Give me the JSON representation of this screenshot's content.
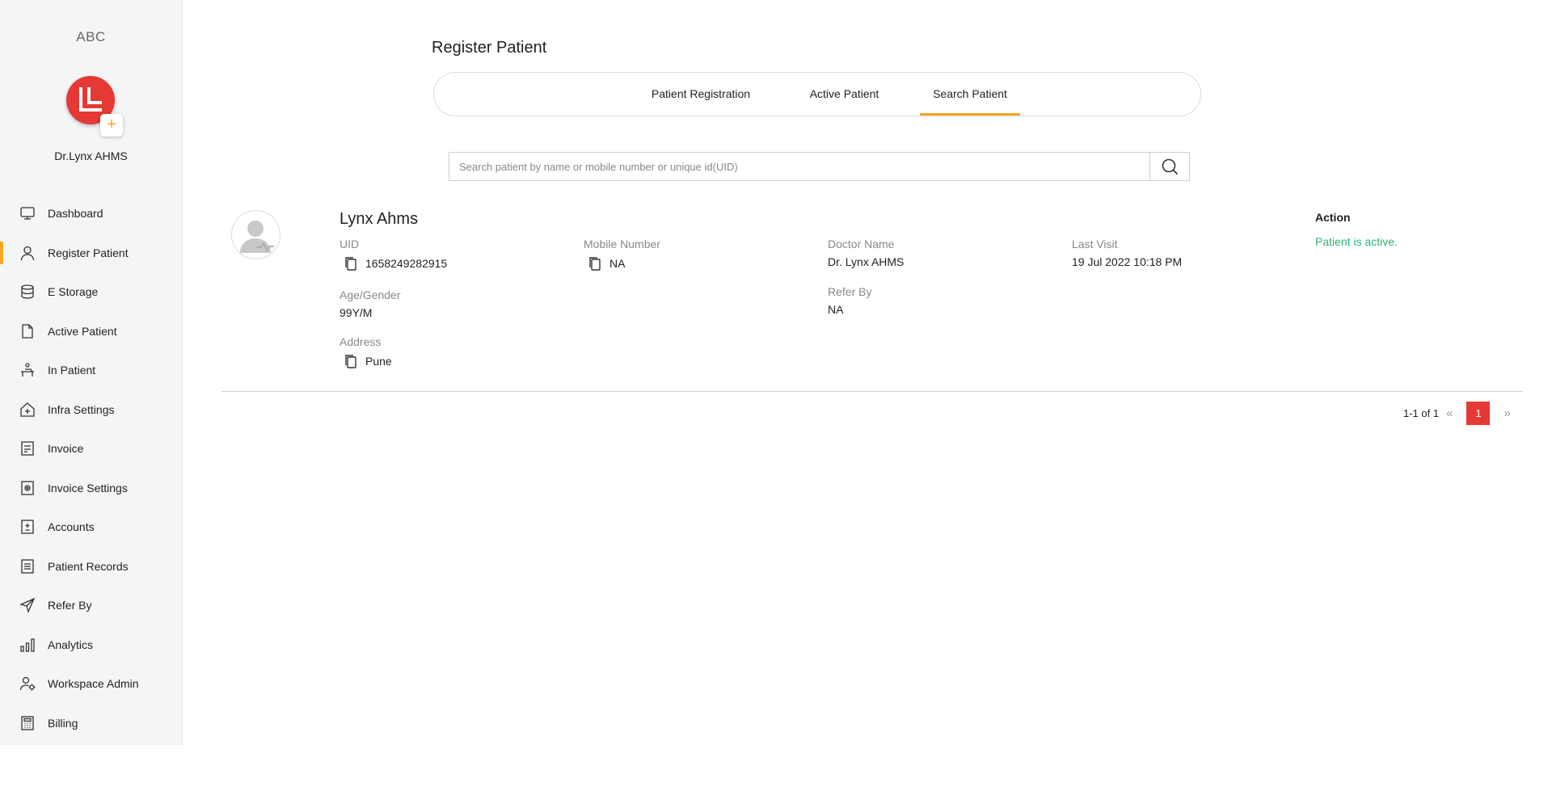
{
  "sidebar": {
    "brand": "ABC",
    "user_name": "Dr.Lynx AHMS",
    "add_symbol": "+",
    "items": [
      {
        "label": "Dashboard",
        "icon": "monitor-icon"
      },
      {
        "label": "Register Patient",
        "icon": "user-icon",
        "active": true
      },
      {
        "label": "E Storage",
        "icon": "database-icon"
      },
      {
        "label": "Active Patient",
        "icon": "file-icon"
      },
      {
        "label": "In Patient",
        "icon": "bed-icon"
      },
      {
        "label": "Infra Settings",
        "icon": "house-plus-icon"
      },
      {
        "label": "Invoice",
        "icon": "invoice-icon"
      },
      {
        "label": "Invoice Settings",
        "icon": "invoice-settings-icon"
      },
      {
        "label": "Accounts",
        "icon": "accounts-icon"
      },
      {
        "label": "Patient Records",
        "icon": "records-icon"
      },
      {
        "label": "Refer By",
        "icon": "send-icon"
      },
      {
        "label": "Analytics",
        "icon": "bar-chart-icon"
      },
      {
        "label": "Workspace Admin",
        "icon": "admin-icon"
      },
      {
        "label": "Billing",
        "icon": "calculator-icon"
      }
    ]
  },
  "main": {
    "title": "Register Patient",
    "tabs": [
      {
        "label": "Patient Registration"
      },
      {
        "label": "Active Patient"
      },
      {
        "label": "Search Patient",
        "active": true
      }
    ],
    "search": {
      "placeholder": "Search patient by name or mobile number or unique id(UID)",
      "value": ""
    },
    "patient": {
      "name": "Lynx Ahms",
      "uid_label": "UID",
      "uid": "1658249282915",
      "mobile_label": "Mobile Number",
      "mobile": "NA",
      "doctor_label": "Doctor Name",
      "doctor": "Dr. Lynx AHMS",
      "last_visit_label": "Last Visit",
      "last_visit": "19 Jul 2022 10:18 PM",
      "age_gender_label": "Age/Gender",
      "age_gender": "99Y/M",
      "refer_by_label": "Refer By",
      "refer_by": "NA",
      "address_label": "Address",
      "address": "Pune",
      "action_label": "Action",
      "action_status": "Patient is active."
    },
    "pagination": {
      "summary": "1-1 of 1",
      "prev": "«",
      "current_page": "1",
      "next": "»"
    }
  },
  "colors": {
    "accent": "#f5a623",
    "brand_red": "#e53935",
    "success": "#2bb673"
  }
}
